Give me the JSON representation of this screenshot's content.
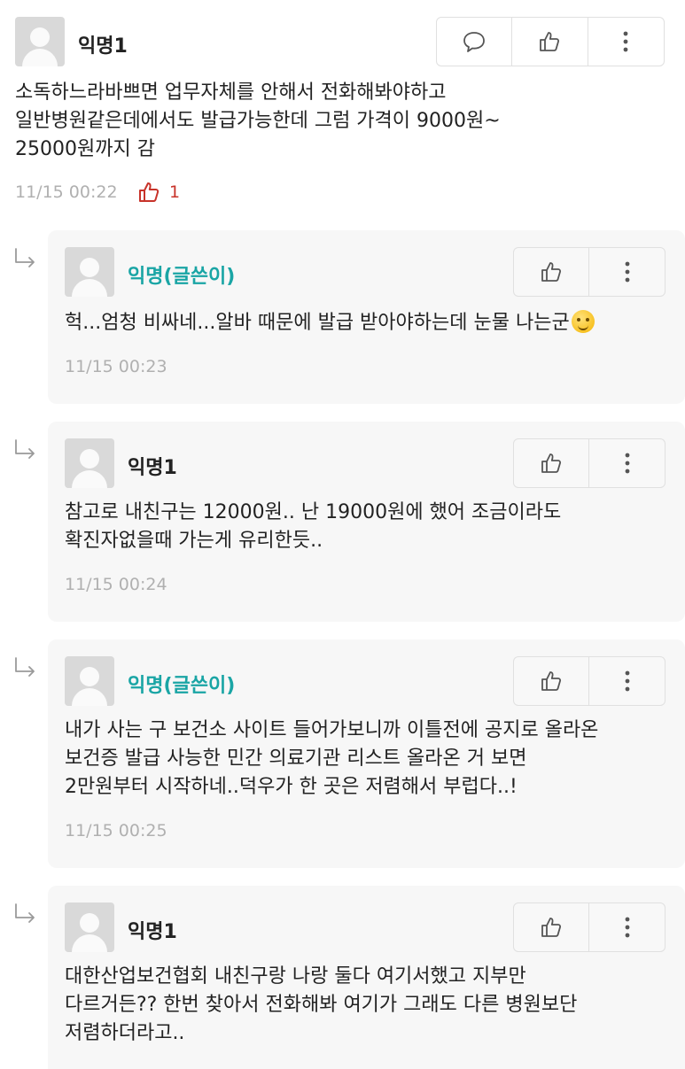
{
  "comments": [
    {
      "author": "익명1",
      "text": "소독하느라바쁘면 업무자체를 안해서 전화해봐야하고\n일반병원같은데에서도 발급가능한데 그럼 가격이 9000원~\n25000원까지 감",
      "time": "11/15 00:22",
      "likes": "1"
    }
  ],
  "replies": [
    {
      "author": "익명(글쓴이)",
      "text": "헉...엄청 비싸네...알바 때문에 발급 받아야하는데 눈물 나는군",
      "emoji": "smiling-face-with-tear",
      "time": "11/15 00:23"
    },
    {
      "author": "익명1",
      "text": "참고로 내친구는 12000원.. 난 19000원에 했어 조금이라도\n확진자없을때 가는게 유리한듯..",
      "time": "11/15 00:24"
    },
    {
      "author": "익명(글쓴이)",
      "text": "내가 사는 구 보건소 사이트 들어가보니까 이틀전에 공지로 올라온\n보건증 발급 사능한 민간 의료기관 리스트 올라온 거 보면\n2만원부터 시작하네..덕우가 한 곳은 저렴해서 부럽다..!",
      "time": "11/15 00:25"
    },
    {
      "author": "익명1",
      "text": "대한산업보건협회 내친구랑 나랑 둘다 여기서했고 지부만\n다르거든?? 한번 찾아서 전화해봐 여기가 그래도 다른 병원보단\n저렴하더라고.."
    }
  ],
  "icons": {
    "comment": "speech-bubble-icon",
    "like": "thumbs-up-icon",
    "more": "vertical-ellipsis-icon",
    "reply": "reply-arrow-icon"
  },
  "colors": {
    "op_author": "#1aa5a5",
    "like_active": "#c8332a",
    "reply_bg": "#f7f7f7"
  }
}
